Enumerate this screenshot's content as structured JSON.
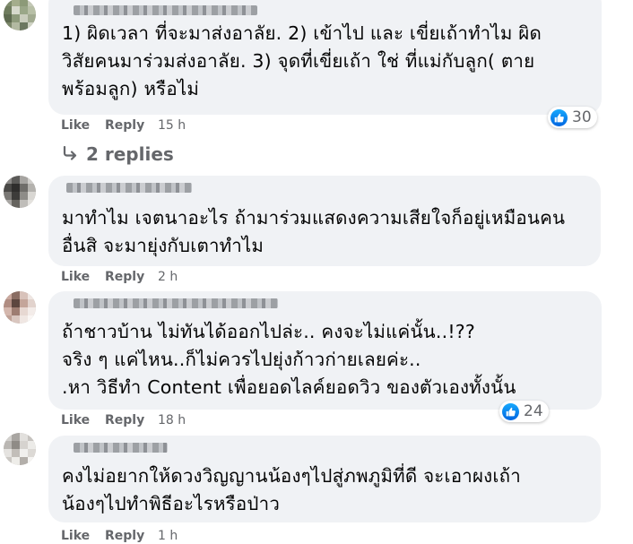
{
  "comments": [
    {
      "lines": [
        "1) ผิดเวลา ที่จะมาส่งอาลัย. 2) เข้าไป และ เขี่ยเถ้าทำไม ผิด",
        "วิสัยคนมาร่วมส่งอาลัย. 3) จุดที่เขี่ยเถ้า ใช่ ที่แม่กับลูก( ตาย",
        "พร้อมลูก) หรือไม่"
      ],
      "like_label": "Like",
      "reply_label": "Reply",
      "time": "15 h",
      "reactions": "30",
      "replies_label": "2 replies"
    },
    {
      "lines": [
        "มาทำไม เจตนาอะไร ถ้ามาร่วมแสดงความเสียใจก็อยู่เหมือนคน",
        "อื่นสิ จะมายุ่งกับเตาทำไม"
      ],
      "like_label": "Like",
      "reply_label": "Reply",
      "time": "2 h"
    },
    {
      "lines": [
        "ถ้าชาวบ้าน ไม่ทันได้ออกไปล่ะ.. คงจะไม่แค่นั้น..!??",
        "จริง ๆ แค่ไหน..ก็ไม่ควรไปยุ่งก้าวก่ายเลยค่ะ..",
        ".หา วิธีทำ Content เพื่อยอดไลค์ยอดวิว ของตัวเองทั้งนั้น"
      ],
      "like_label": "Like",
      "reply_label": "Reply",
      "time": "18 h",
      "reactions": "24"
    },
    {
      "lines": [
        "คงไม่อยากให้ดวงวิญญานน้องๆไปสู่ภพภูมิที่ดี จะเอาผงเถ้า",
        "น้องๆไปทำพิธีอะไรหรือป่าว"
      ],
      "like_label": "Like",
      "reply_label": "Reply",
      "time": "1 h"
    }
  ],
  "colors": {
    "bubble": "#f0f2f5",
    "meta_text": "#65676b",
    "like_blue": "#0571ed"
  },
  "icons": {
    "reaction": "like-thumb-icon",
    "replies": "reply-arrow-icon"
  }
}
